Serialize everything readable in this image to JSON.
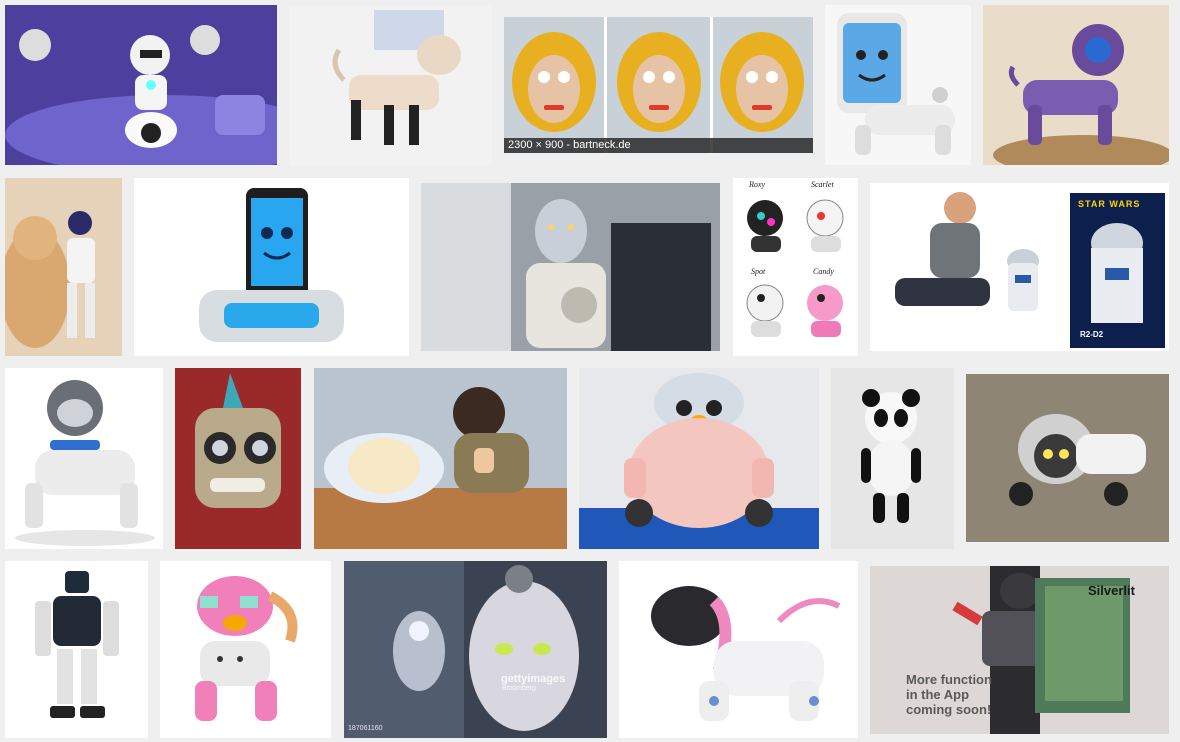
{
  "results": {
    "caption_text": "2300 × 900 - bartneck.de",
    "zoomer_labels": [
      "Roxy",
      "Scarlet",
      "Spot",
      "Candy"
    ],
    "starwars_box": "STAR WARS",
    "starwars_box_model": "R2-D2",
    "getty_watermark": "gettyimages",
    "getty_sub": "Bloomberg",
    "getty_id": "187061160",
    "silverlit_brand": "Silverlit",
    "app_promo": [
      "More function",
      "in the App",
      "coming soon!"
    ]
  },
  "colors": {
    "page_background": "#efefef",
    "caption_background": "#232323",
    "caption_text": "#ffffff"
  }
}
